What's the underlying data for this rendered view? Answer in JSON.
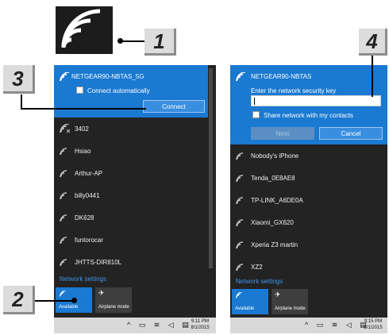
{
  "callouts": {
    "c1": "1",
    "c2": "2",
    "c3": "3",
    "c4": "4"
  },
  "left_panel": {
    "selected_network": "NETGEAR90-NBTAS_5G",
    "connect_auto_label": "Connect automatically",
    "connect_button": "Connect",
    "networks": [
      "3402",
      "Hsiao",
      "Arthur-AP",
      "billy0441",
      "DK628",
      "funtorocar",
      "JHTTS-DIR810L"
    ],
    "network_settings": "Network settings",
    "tiles": {
      "wifi": "Available",
      "airplane": "Airplane mode"
    },
    "clock": {
      "time": "9:11 PM",
      "date": "8/1/2015"
    }
  },
  "right_panel": {
    "selected_network": "NETGEAR90-NBTAS",
    "prompt": "Enter the network security key",
    "share_label": "Share network with my contacts",
    "next_button": "Next",
    "cancel_button": "Cancel",
    "networks": [
      "Nobody's iPhone",
      "Tenda_0E8AE8",
      "TP-LINK_A6DE0A",
      "Xiaomi_GX620",
      "Xperia Z3 martin",
      "XZ2"
    ],
    "network_settings": "Network settings",
    "tiles": {
      "wifi": "Available",
      "airplane": "Airplane mode"
    },
    "clock": {
      "time": "9:15 PM",
      "date": "8/1/2015"
    }
  }
}
